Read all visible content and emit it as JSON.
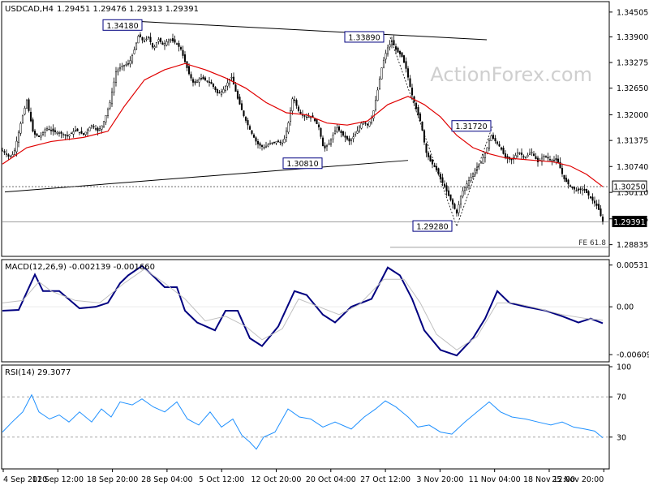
{
  "header": {
    "symbol": "USDCAD,H4",
    "ohlc": "1.29451 1.29476 1.29313 1.29391"
  },
  "watermark": "ActionForex.com",
  "colors": {
    "candle": "#000000",
    "ma": "#e00000",
    "trendline": "#000000",
    "macd_main": "#000080",
    "macd_signal": "#c0c0c0",
    "rsi": "#1e90ff",
    "grid": "#e6e6e6",
    "dotted_level": "#555555"
  },
  "chart_data": [
    {
      "type": "candlestick",
      "panel": "price",
      "ylim": [
        1.2859,
        1.3472
      ],
      "y_ticks": [
        "1.34505",
        "1.33900",
        "1.33275",
        "1.32650",
        "1.32000",
        "1.31375",
        "1.30740",
        "1.30110",
        "1.29465",
        "1.28835"
      ],
      "y_tick_values": [
        1.34505,
        1.339,
        1.33275,
        1.3265,
        1.32,
        1.31375,
        1.3074,
        1.3011,
        1.29465,
        1.28835
      ],
      "x_ticks": [
        "4 Sep 2020",
        "11 Sep 12:00",
        "18 Sep 20:00",
        "28 Sep 04:00",
        "5 Oct 12:00",
        "12 Oct 20:00",
        "20 Oct 04:00",
        "27 Oct 12:00",
        "3 Nov 20:00",
        "11 Nov 04:00",
        "18 Nov 12:00",
        "25 Nov 20:00"
      ],
      "close_path": [
        [
          0,
          1.3113
        ],
        [
          8,
          1.3098
        ],
        [
          14,
          1.3105
        ],
        [
          22,
          1.3175
        ],
        [
          30,
          1.3235
        ],
        [
          38,
          1.3155
        ],
        [
          46,
          1.3145
        ],
        [
          54,
          1.3168
        ],
        [
          62,
          1.316
        ],
        [
          72,
          1.3155
        ],
        [
          80,
          1.3148
        ],
        [
          90,
          1.3163
        ],
        [
          100,
          1.3152
        ],
        [
          110,
          1.3175
        ],
        [
          118,
          1.316
        ],
        [
          124,
          1.3178
        ],
        [
          132,
          1.3225
        ],
        [
          140,
          1.3305
        ],
        [
          148,
          1.332
        ],
        [
          156,
          1.3325
        ],
        [
          162,
          1.3355
        ],
        [
          168,
          1.3395
        ],
        [
          174,
          1.3378
        ],
        [
          180,
          1.339
        ],
        [
          186,
          1.336
        ],
        [
          192,
          1.3385
        ],
        [
          198,
          1.337
        ],
        [
          206,
          1.3385
        ],
        [
          214,
          1.3375
        ],
        [
          220,
          1.336
        ],
        [
          224,
          1.3335
        ],
        [
          230,
          1.33
        ],
        [
          236,
          1.3275
        ],
        [
          244,
          1.329
        ],
        [
          250,
          1.3285
        ],
        [
          258,
          1.3275
        ],
        [
          266,
          1.325
        ],
        [
          274,
          1.3265
        ],
        [
          282,
          1.3295
        ],
        [
          290,
          1.324
        ],
        [
          298,
          1.3195
        ],
        [
          306,
          1.316
        ],
        [
          314,
          1.313
        ],
        [
          322,
          1.312
        ],
        [
          330,
          1.313
        ],
        [
          338,
          1.3135
        ],
        [
          346,
          1.313
        ],
        [
          352,
          1.3175
        ],
        [
          358,
          1.3245
        ],
        [
          366,
          1.3205
        ],
        [
          374,
          1.3195
        ],
        [
          382,
          1.3195
        ],
        [
          390,
          1.317
        ],
        [
          396,
          1.3115
        ],
        [
          404,
          1.3135
        ],
        [
          412,
          1.317
        ],
        [
          420,
          1.315
        ],
        [
          428,
          1.3135
        ],
        [
          436,
          1.3155
        ],
        [
          444,
          1.3185
        ],
        [
          450,
          1.3175
        ],
        [
          456,
          1.3195
        ],
        [
          462,
          1.3255
        ],
        [
          468,
          1.332
        ],
        [
          474,
          1.336
        ],
        [
          480,
          1.338
        ],
        [
          486,
          1.3355
        ],
        [
          492,
          1.3345
        ],
        [
          498,
          1.331
        ],
        [
          504,
          1.3255
        ],
        [
          510,
          1.3215
        ],
        [
          516,
          1.318
        ],
        [
          522,
          1.311
        ],
        [
          528,
          1.3085
        ],
        [
          534,
          1.307
        ],
        [
          540,
          1.3045
        ],
        [
          546,
          1.302
        ],
        [
          552,
          1.2995
        ],
        [
          560,
          1.296
        ],
        [
          566,
          1.301
        ],
        [
          572,
          1.303
        ],
        [
          578,
          1.305
        ],
        [
          584,
          1.307
        ],
        [
          590,
          1.3085
        ],
        [
          596,
          1.311
        ],
        [
          602,
          1.315
        ],
        [
          608,
          1.3135
        ],
        [
          614,
          1.312
        ],
        [
          620,
          1.3095
        ],
        [
          628,
          1.309
        ],
        [
          636,
          1.311
        ],
        [
          644,
          1.3095
        ],
        [
          652,
          1.311
        ],
        [
          660,
          1.3085
        ],
        [
          668,
          1.31
        ],
        [
          676,
          1.309
        ],
        [
          684,
          1.309
        ],
        [
          692,
          1.3045
        ],
        [
          700,
          1.3025
        ],
        [
          708,
          1.3015
        ],
        [
          716,
          1.302
        ],
        [
          722,
          1.3005
        ],
        [
          728,
          1.299
        ],
        [
          734,
          1.2975
        ],
        [
          740,
          1.2939
        ]
      ],
      "ma_path": [
        [
          0,
          1.308
        ],
        [
          30,
          1.312
        ],
        [
          60,
          1.3135
        ],
        [
          100,
          1.3145
        ],
        [
          130,
          1.316
        ],
        [
          150,
          1.322
        ],
        [
          175,
          1.3285
        ],
        [
          200,
          1.331
        ],
        [
          225,
          1.3325
        ],
        [
          250,
          1.331
        ],
        [
          275,
          1.329
        ],
        [
          300,
          1.3265
        ],
        [
          325,
          1.323
        ],
        [
          350,
          1.3205
        ],
        [
          375,
          1.32
        ],
        [
          400,
          1.318
        ],
        [
          425,
          1.3175
        ],
        [
          450,
          1.3185
        ],
        [
          475,
          1.3225
        ],
        [
          500,
          1.3245
        ],
        [
          520,
          1.3225
        ],
        [
          540,
          1.3195
        ],
        [
          560,
          1.315
        ],
        [
          580,
          1.312
        ],
        [
          600,
          1.3105
        ],
        [
          620,
          1.3095
        ],
        [
          650,
          1.309
        ],
        [
          680,
          1.3085
        ],
        [
          700,
          1.3075
        ],
        [
          720,
          1.3055
        ],
        [
          740,
          1.3025
        ]
      ],
      "annotations": [
        {
          "label": "1.34180",
          "x": 148,
          "value": 1.3418
        },
        {
          "label": "1.33890",
          "x": 446,
          "value": 1.3389
        },
        {
          "label": "1.31720",
          "x": 578,
          "value": 1.3172
        },
        {
          "label": "1.30810",
          "x": 370,
          "value": 1.3081
        },
        {
          "label": "1.29280",
          "x": 530,
          "value": 1.2928
        }
      ],
      "trendlines": [
        {
          "from": [
            165,
            1.3428
          ],
          "to": [
            597,
            1.3383
          ]
        },
        {
          "from": [
            3,
            1.3012
          ],
          "to": [
            500,
            1.3089
          ]
        }
      ],
      "dotted_path": [
        [
          478,
          1.3389
        ],
        [
          560,
          1.2928
        ],
        [
          604,
          1.3172
        ]
      ],
      "levels": [
        {
          "label": "1.30250",
          "value": 1.3025,
          "style": "dotted",
          "tag_fill": "#ffffff"
        },
        {
          "label": "1.29391",
          "value": 1.29391,
          "style": "solid",
          "tag_fill": "#000000"
        }
      ],
      "fe_label": "FE 61.8",
      "fe_value": 1.2877,
      "fe_from_x": 478
    },
    {
      "type": "line",
      "panel": "macd",
      "title": "MACD(12,26,9) -0.002139 -0.001660",
      "ylim": [
        -0.0068,
        0.0058
      ],
      "y_ticks": [
        "0.005312",
        "0.00",
        "-0.006092"
      ],
      "y_tick_values": [
        0.005312,
        0.0,
        -0.006092
      ],
      "series": [
        {
          "role": "macd",
          "points": [
            [
              0,
              -0.0005
            ],
            [
              20,
              -0.0004
            ],
            [
              40,
              0.0041
            ],
            [
              50,
              0.002
            ],
            [
              70,
              0.002
            ],
            [
              95,
              -0.0002
            ],
            [
              115,
              0.0
            ],
            [
              130,
              0.0005
            ],
            [
              145,
              0.003
            ],
            [
              155,
              0.004
            ],
            [
              172,
              0.0052
            ],
            [
              185,
              0.004
            ],
            [
              200,
              0.0025
            ],
            [
              215,
              0.0025
            ],
            [
              225,
              -0.0005
            ],
            [
              240,
              -0.002
            ],
            [
              262,
              -0.003
            ],
            [
              275,
              -0.0005
            ],
            [
              290,
              -0.0005
            ],
            [
              305,
              -0.004
            ],
            [
              320,
              -0.005
            ],
            [
              340,
              -0.0025
            ],
            [
              360,
              0.002
            ],
            [
              375,
              0.0015
            ],
            [
              395,
              -0.001
            ],
            [
              410,
              -0.002
            ],
            [
              430,
              0.0
            ],
            [
              455,
              0.001
            ],
            [
              475,
              0.005
            ],
            [
              490,
              0.004
            ],
            [
              505,
              0.001
            ],
            [
              520,
              -0.003
            ],
            [
              540,
              -0.0055
            ],
            [
              560,
              -0.0062
            ],
            [
              580,
              -0.004
            ],
            [
              595,
              -0.0015
            ],
            [
              610,
              0.002
            ],
            [
              625,
              0.0005
            ],
            [
              645,
              0.0
            ],
            [
              670,
              -0.0005
            ],
            [
              690,
              -0.0012
            ],
            [
              710,
              -0.002
            ],
            [
              725,
              -0.0015
            ],
            [
              740,
              -0.0021
            ]
          ]
        },
        {
          "role": "signal",
          "points": [
            [
              0,
              0.0005
            ],
            [
              25,
              0.0008
            ],
            [
              45,
              0.0032
            ],
            [
              60,
              0.002
            ],
            [
              90,
              0.0008
            ],
            [
              120,
              0.0005
            ],
            [
              150,
              0.003
            ],
            [
              175,
              0.0048
            ],
            [
              200,
              0.003
            ],
            [
              225,
              0.001
            ],
            [
              250,
              -0.0018
            ],
            [
              275,
              -0.0012
            ],
            [
              300,
              -0.0025
            ],
            [
              320,
              -0.0042
            ],
            [
              345,
              -0.0028
            ],
            [
              365,
              0.001
            ],
            [
              390,
              0.0
            ],
            [
              415,
              -0.001
            ],
            [
              440,
              0.0003
            ],
            [
              470,
              0.0035
            ],
            [
              495,
              0.0035
            ],
            [
              515,
              0.0005
            ],
            [
              535,
              -0.0035
            ],
            [
              560,
              -0.0055
            ],
            [
              585,
              -0.0038
            ],
            [
              610,
              0.0005
            ],
            [
              630,
              0.0005
            ],
            [
              660,
              -0.0002
            ],
            [
              690,
              -0.001
            ],
            [
              720,
              -0.0015
            ],
            [
              740,
              -0.0017
            ]
          ]
        }
      ]
    },
    {
      "type": "line",
      "panel": "rsi",
      "title": "RSI(14) 29.3077",
      "ylim": [
        0,
        100
      ],
      "y_ticks": [
        "100",
        "70",
        "30"
      ],
      "y_tick_values": [
        100,
        70,
        30
      ],
      "levels": [
        70,
        30
      ],
      "series": [
        {
          "role": "rsi",
          "points": [
            [
              0,
              35
            ],
            [
              12,
              45
            ],
            [
              25,
              55
            ],
            [
              36,
              72
            ],
            [
              45,
              55
            ],
            [
              58,
              48
            ],
            [
              70,
              52
            ],
            [
              82,
              45
            ],
            [
              95,
              55
            ],
            [
              110,
              45
            ],
            [
              122,
              58
            ],
            [
              134,
              50
            ],
            [
              145,
              65
            ],
            [
              160,
              62
            ],
            [
              172,
              68
            ],
            [
              186,
              60
            ],
            [
              200,
              55
            ],
            [
              215,
              65
            ],
            [
              228,
              48
            ],
            [
              242,
              42
            ],
            [
              256,
              55
            ],
            [
              270,
              40
            ],
            [
              284,
              48
            ],
            [
              295,
              32
            ],
            [
              305,
              25
            ],
            [
              313,
              18
            ],
            [
              322,
              30
            ],
            [
              336,
              35
            ],
            [
              352,
              58
            ],
            [
              366,
              50
            ],
            [
              380,
              48
            ],
            [
              395,
              40
            ],
            [
              410,
              45
            ],
            [
              430,
              38
            ],
            [
              446,
              50
            ],
            [
              460,
              58
            ],
            [
              472,
              66
            ],
            [
              485,
              60
            ],
            [
              500,
              50
            ],
            [
              512,
              40
            ],
            [
              526,
              42
            ],
            [
              540,
              35
            ],
            [
              554,
              33
            ],
            [
              570,
              45
            ],
            [
              585,
              55
            ],
            [
              600,
              65
            ],
            [
              614,
              55
            ],
            [
              628,
              50
            ],
            [
              645,
              48
            ],
            [
              660,
              45
            ],
            [
              676,
              42
            ],
            [
              690,
              45
            ],
            [
              704,
              40
            ],
            [
              718,
              38
            ],
            [
              730,
              36
            ],
            [
              740,
              29.3
            ]
          ]
        }
      ]
    }
  ]
}
